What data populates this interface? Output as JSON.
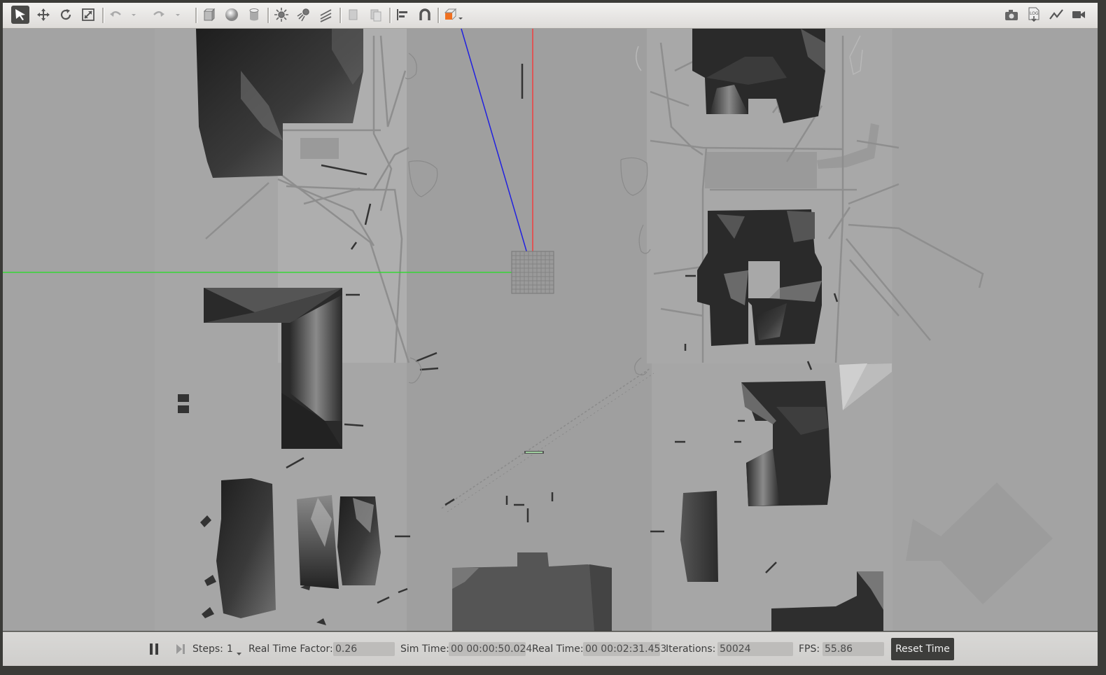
{
  "toolbar": {
    "left_tools": [
      "select-mode-icon",
      "translate-mode-icon",
      "rotate-mode-icon",
      "scale-mode-icon",
      "undo-icon",
      "undo-history-icon",
      "redo-icon",
      "redo-history-icon",
      "box-shape-icon",
      "sphere-shape-icon",
      "cylinder-shape-icon",
      "point-light-icon",
      "spot-light-icon",
      "directional-light-icon",
      "copy-icon",
      "paste-icon",
      "align-icon",
      "snap-magnet-icon",
      "view-angle-icon"
    ],
    "right_tools": [
      "screenshot-icon",
      "log-icon",
      "plot-icon",
      "record-video-icon"
    ],
    "log_label": "LOG"
  },
  "bottom_bar": {
    "steps_label": "Steps:",
    "steps_value": "1",
    "rtf_label": "Real Time Factor:",
    "rtf_value": "0.26",
    "sim_time_label": "Sim Time:",
    "sim_time_value": "00 00:00:50.024",
    "real_time_label": "Real Time:",
    "real_time_value": "00 00:02:31.453",
    "iterations_label": "Iterations:",
    "iterations_value": "50024",
    "fps_label": "FPS:",
    "fps_value": "55.86",
    "reset_label": "Reset Time"
  },
  "colors": {
    "x_axis": "#ff3030",
    "y_axis": "#20e020",
    "z_axis": "#2020e0",
    "selected_tool": "#4a4a48",
    "view_angle_accent": "#f07020"
  }
}
